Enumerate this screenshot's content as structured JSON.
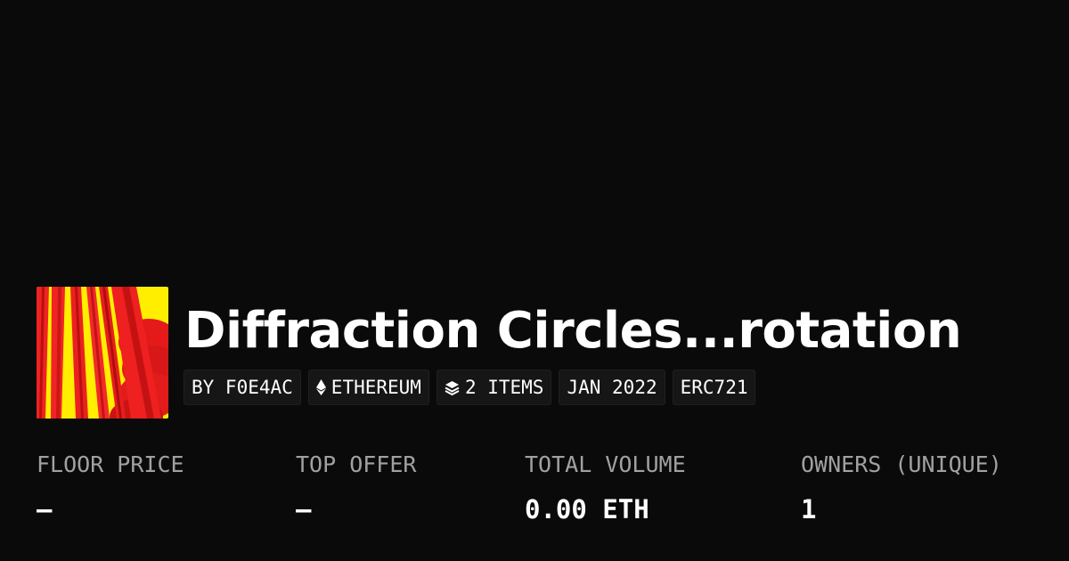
{
  "collection": {
    "title": "Diffraction Circles...rotation"
  },
  "tags": [
    {
      "label": "BY F0E4AC",
      "icon": null
    },
    {
      "label": "ETHEREUM",
      "icon": "ethereum-icon"
    },
    {
      "label": "2 ITEMS",
      "icon": "layers-icon"
    },
    {
      "label": "JAN 2022",
      "icon": null
    },
    {
      "label": "ERC721",
      "icon": null
    }
  ],
  "stats": [
    {
      "label": "FLOOR PRICE",
      "value": "–"
    },
    {
      "label": "TOP OFFER",
      "value": "–"
    },
    {
      "label": "TOTAL VOLUME",
      "value": "0.00 ETH"
    },
    {
      "label": "OWNERS (UNIQUE)",
      "value": "1"
    }
  ],
  "colors": {
    "background": "#0a0a0a",
    "tag_background": "#161616",
    "label_gray": "#a1a1a1",
    "text": "#ffffff",
    "artwork_yellow": "#ffee00",
    "artwork_red": "#ee1c1c"
  }
}
